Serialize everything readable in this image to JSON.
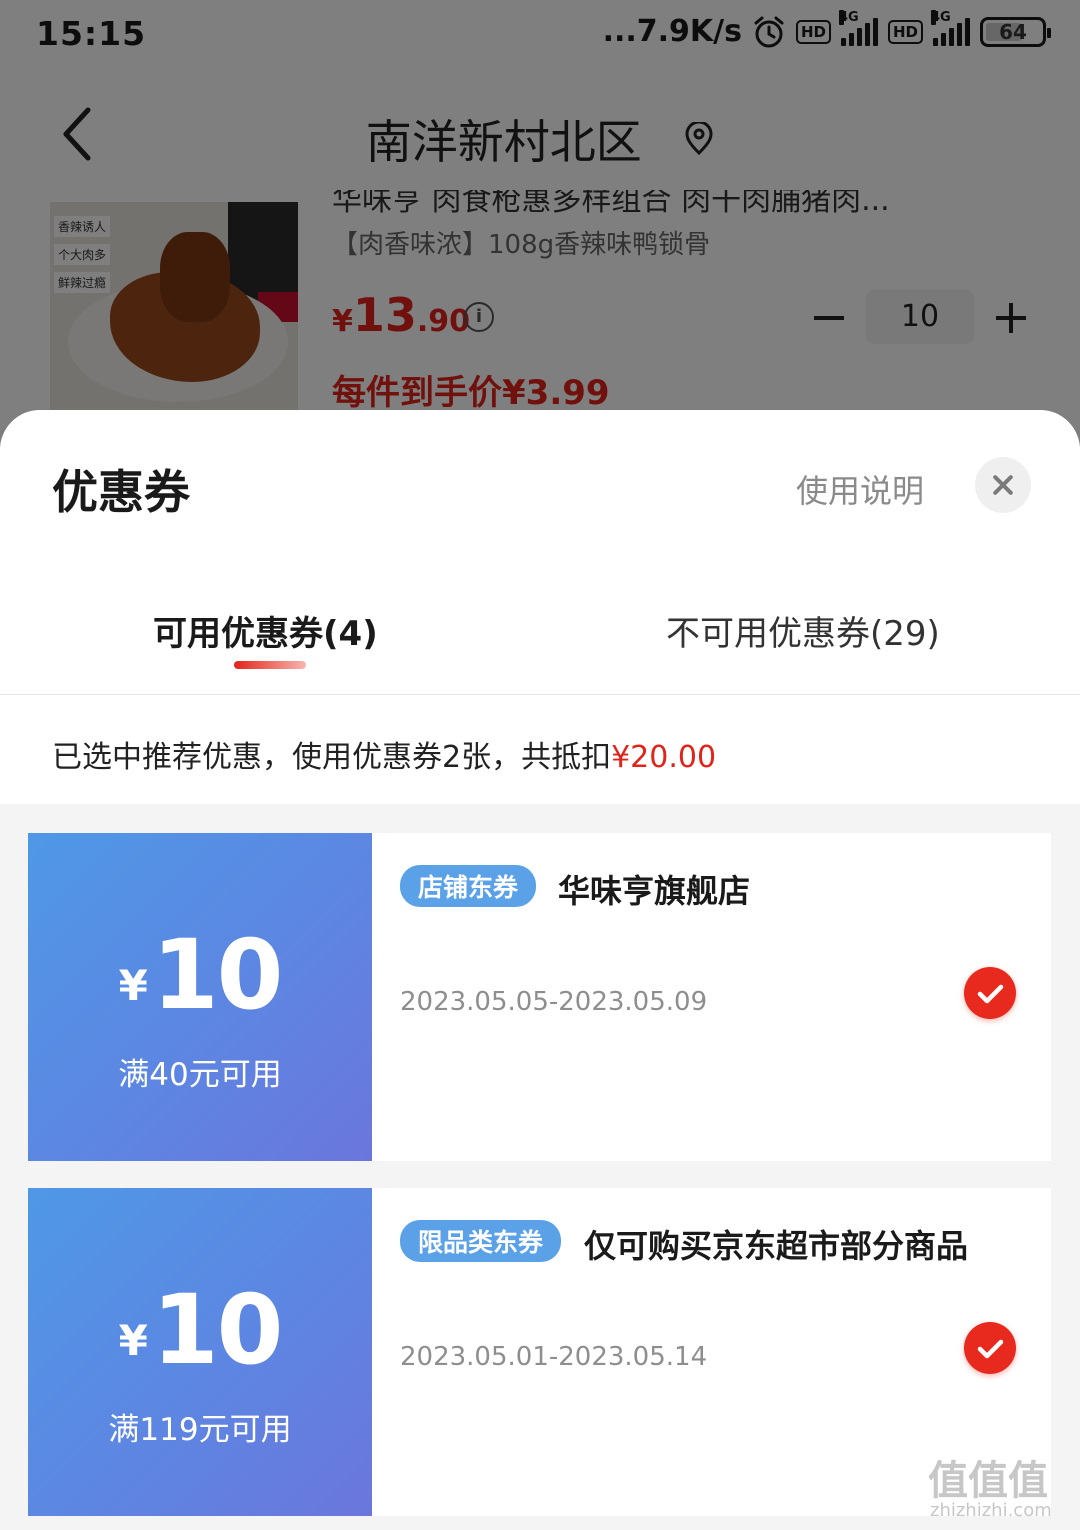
{
  "status_bar": {
    "time": "15:15",
    "speed": "...7.9K/s",
    "hd1": "HD",
    "hd2": "HD",
    "net1": "4G",
    "net2": "4G",
    "battery": "64"
  },
  "nav": {
    "title": "南洋新村北区"
  },
  "product": {
    "name": "华味亨 肉食枪惠多样组合 肉干肉脯猪肉...",
    "subtitle": "【肉香味浓】108g香辣味鸭锁骨",
    "price_symbol": "¥",
    "price_int": "13",
    "price_dec": ".90",
    "quantity": "10",
    "final_price": "每件到手价¥3.99",
    "image_tags": [
      "香辣诱人",
      "个大肉多",
      "鲜辣过瘾"
    ]
  },
  "sheet": {
    "title": "优惠券",
    "usage_link": "使用说明",
    "tabs": [
      {
        "label": "可用优惠券(4)",
        "active": true
      },
      {
        "label": "不可用优惠券(29)",
        "active": false
      }
    ],
    "summary_text": "已选中推荐优惠，使用优惠券2张，共抵扣",
    "summary_amount": "¥20.00"
  },
  "coupons": [
    {
      "symbol": "¥",
      "amount": "10",
      "condition": "满40元可用",
      "tag": "店铺东券",
      "name": "华味亨旗舰店",
      "date": "2023.05.05-2023.05.09",
      "checked": true
    },
    {
      "symbol": "¥",
      "amount": "10",
      "condition": "满119元可用",
      "tag": "限品类东券",
      "name": "仅可购买京东超市部分商品",
      "date": "2023.05.01-2023.05.14",
      "checked": true
    }
  ],
  "watermark": {
    "main": "值值值",
    "sub": "zhizhizhi.com"
  },
  "colors": {
    "accent_red": "#e2231a",
    "coupon_blue_start": "#4f98e6",
    "coupon_blue_end": "#6b76dc",
    "tag_blue": "#5aa1e8"
  }
}
